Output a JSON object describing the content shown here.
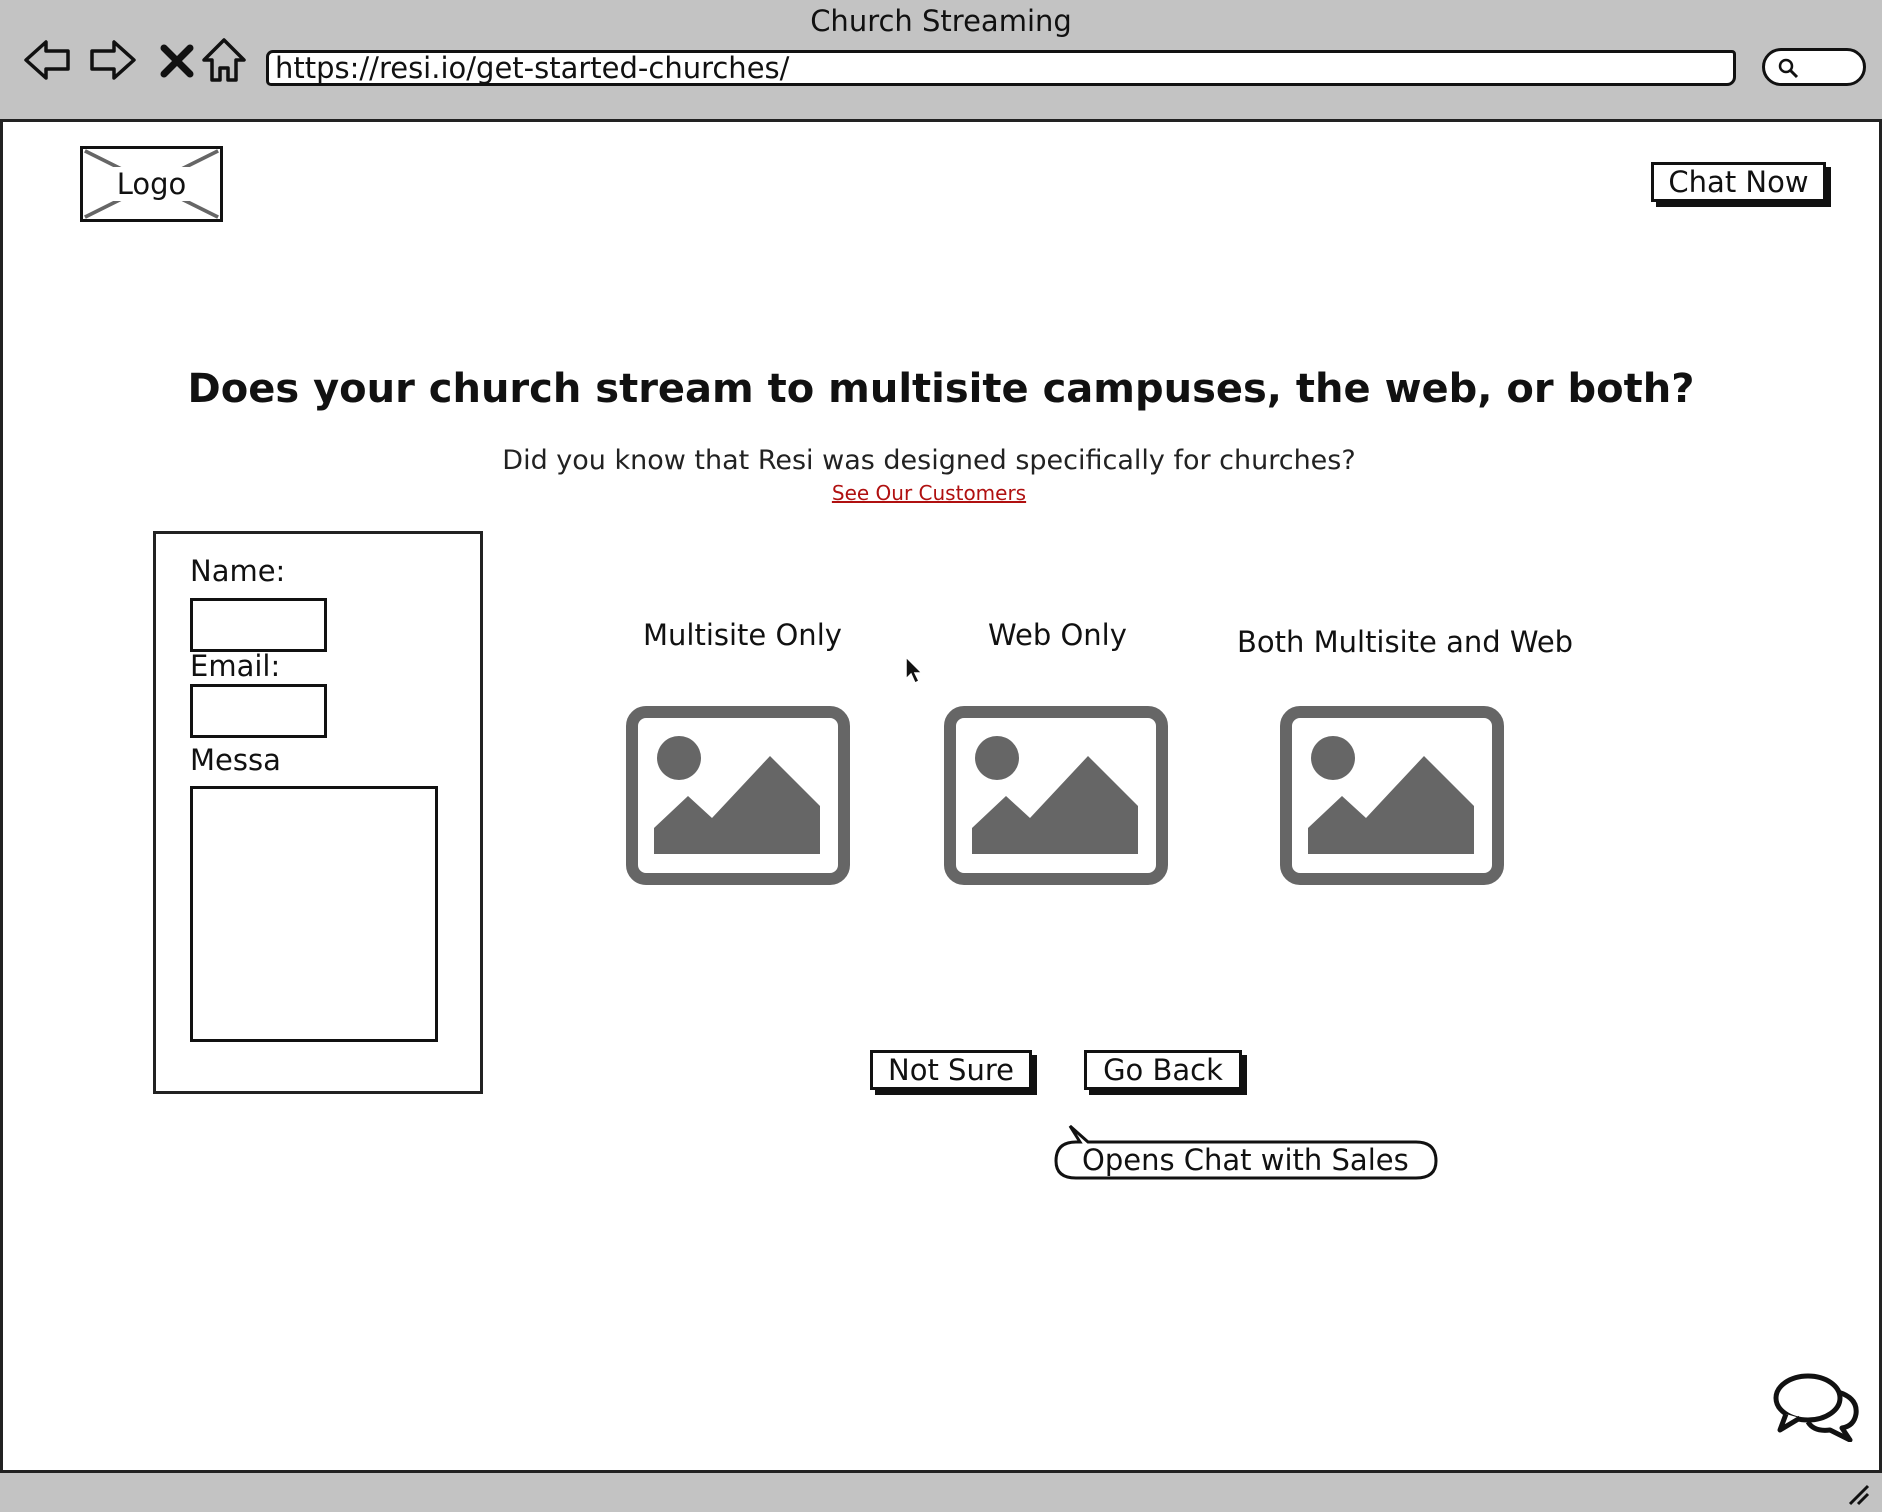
{
  "window": {
    "title": "Church Streaming",
    "url": "https://resi.io/get-started-churches/"
  },
  "header": {
    "logo_label": "Logo",
    "chat_now_label": "Chat Now"
  },
  "main": {
    "headline": "Does your church stream to multisite campuses, the web, or both?",
    "subline": "Did you know that Resi was designed specifically for churches?",
    "customers_link": "See Our Customers"
  },
  "form": {
    "name_label": "Name:",
    "email_label": "Email:",
    "message_label": "Messa"
  },
  "options": [
    {
      "label": "Multisite Only",
      "icon": "image-placeholder-icon"
    },
    {
      "label": "Web Only",
      "icon": "image-placeholder-icon"
    },
    {
      "label": "Both Multisite and Web",
      "icon": "image-placeholder-icon"
    }
  ],
  "actions": {
    "not_sure_label": "Not Sure",
    "go_back_label": "Go Back",
    "callout_note": "Opens Chat with Sales"
  },
  "colors": {
    "chrome_bg": "#c3c3c3",
    "placeholder_gray": "#666666",
    "link_red": "#b01010"
  }
}
